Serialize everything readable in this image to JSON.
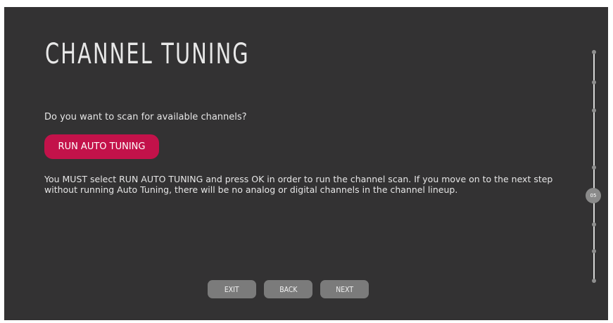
{
  "page": {
    "title": "CHANNEL TUNING",
    "question": "Do you want to scan for available channels?",
    "run_button_label": "RUN AUTO TUNING",
    "note": "You MUST select RUN AUTO TUNING and press OK in order to run the channel scan. If you move on to the next step without running Auto Tuning, there will be no analog or digital channels in the channel lineup."
  },
  "nav": {
    "exit_label": "EXIT",
    "back_label": "BACK",
    "next_label": "NEXT"
  },
  "progress": {
    "current_step_label": "05"
  },
  "colors": {
    "background": "#333233",
    "accent": "#c3124a",
    "nav_button": "#7b7b7b"
  }
}
